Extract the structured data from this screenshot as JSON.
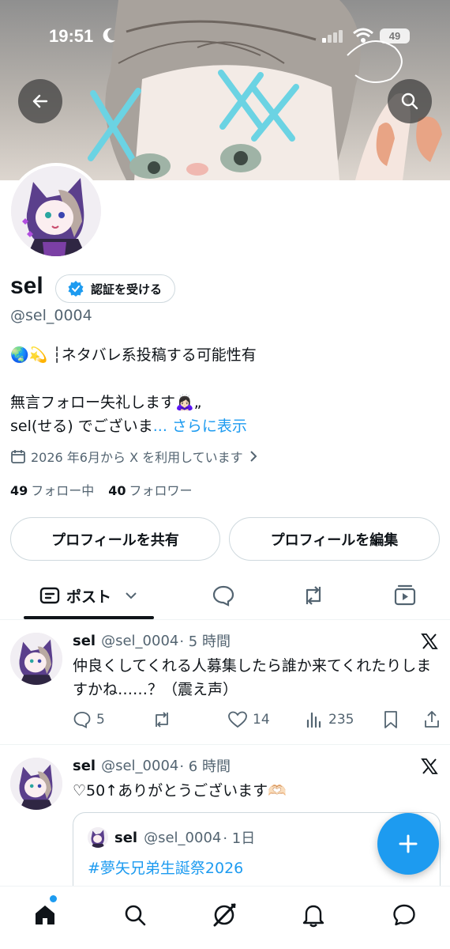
{
  "status_bar": {
    "time": "19:51",
    "battery": "49"
  },
  "profile": {
    "name": "sel",
    "verify_label": "認証を受ける",
    "handle": "@sel_0004",
    "bio_line1": "🌏💫 ┆ネタバレ系投稿する可能性有",
    "bio_line2": "無言フォロー失礼します🙇🏻‍♀️„",
    "bio_line3": "sel(せる) でございま",
    "bio_more_ellipsis": "...",
    "bio_more": "さらに表示",
    "joined": "2026 年6月から X を利用しています",
    "following_count": "49",
    "following_label": "フォロー中",
    "followers_count": "40",
    "followers_label": "フォロワー"
  },
  "buttons": {
    "share": "プロフィールを共有",
    "edit": "プロフィールを編集"
  },
  "tabs": {
    "posts_label": "ポスト"
  },
  "posts": [
    {
      "name": "sel",
      "handle": "@sel_0004",
      "time": "· 5 時間",
      "text": "仲良くしてくれる人募集したら誰か来てくれたりしますかね……？（震え声）",
      "replies": "5",
      "likes": "14",
      "views": "235"
    },
    {
      "name": "sel",
      "handle": "@sel_0004",
      "time": "· 6 時間",
      "text": "♡50↑ありがとうございます🫶🏻",
      "quote": {
        "name": "sel",
        "handle": "@sel_0004",
        "time": "· 1日",
        "text": "#夢矢兄弟生誕祭2026"
      }
    }
  ],
  "colors": {
    "accent": "#1d9bf0",
    "text": "#0f1419",
    "secondary": "#536471",
    "border": "#cfd9de"
  },
  "icons": [
    "back-arrow-icon",
    "search-icon",
    "verified-badge-icon",
    "calendar-icon",
    "chevron-right-icon",
    "post-tab-icon",
    "chevron-down-icon",
    "reply-icon",
    "repost-icon",
    "like-icon",
    "views-icon",
    "bookmark-icon",
    "share-icon",
    "x-logo-icon",
    "compose-plus-icon",
    "home-icon",
    "grok-icon",
    "bell-icon",
    "messages-icon"
  ]
}
